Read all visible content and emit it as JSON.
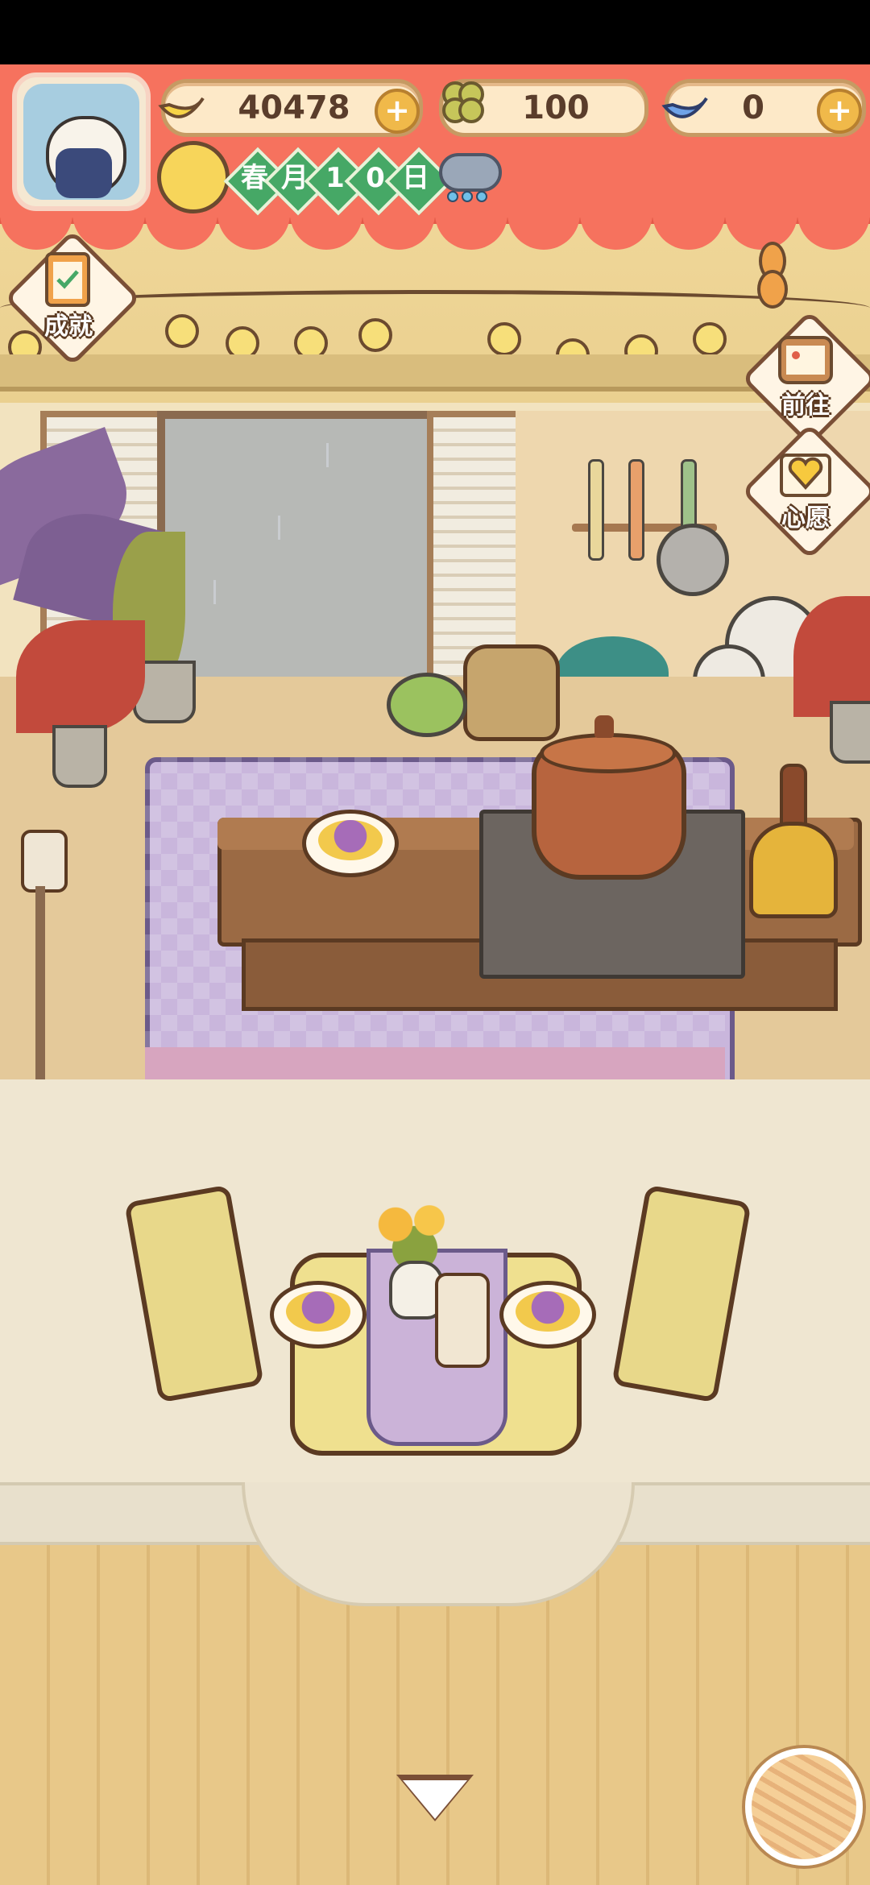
{
  "hud": {
    "bananas": {
      "value": "40478",
      "icon": "banana-icon"
    },
    "clovers": {
      "value": "100",
      "icon": "clover-icon"
    },
    "special_bananas": {
      "value": "0",
      "icon": "blue-banana-icon"
    },
    "plus_label": "+",
    "date": {
      "season": "春",
      "month_label": "月",
      "day_digits": [
        "1",
        "0"
      ],
      "day_label": "日"
    },
    "weather_icon": "rain-cloud-icon"
  },
  "side_buttons": {
    "achievements": "成就",
    "go_to": "前往",
    "wishes": "心愿"
  },
  "colors": {
    "banner": "#f6725e",
    "accent_green": "#46a866",
    "wood_dark": "#5b3a22"
  }
}
